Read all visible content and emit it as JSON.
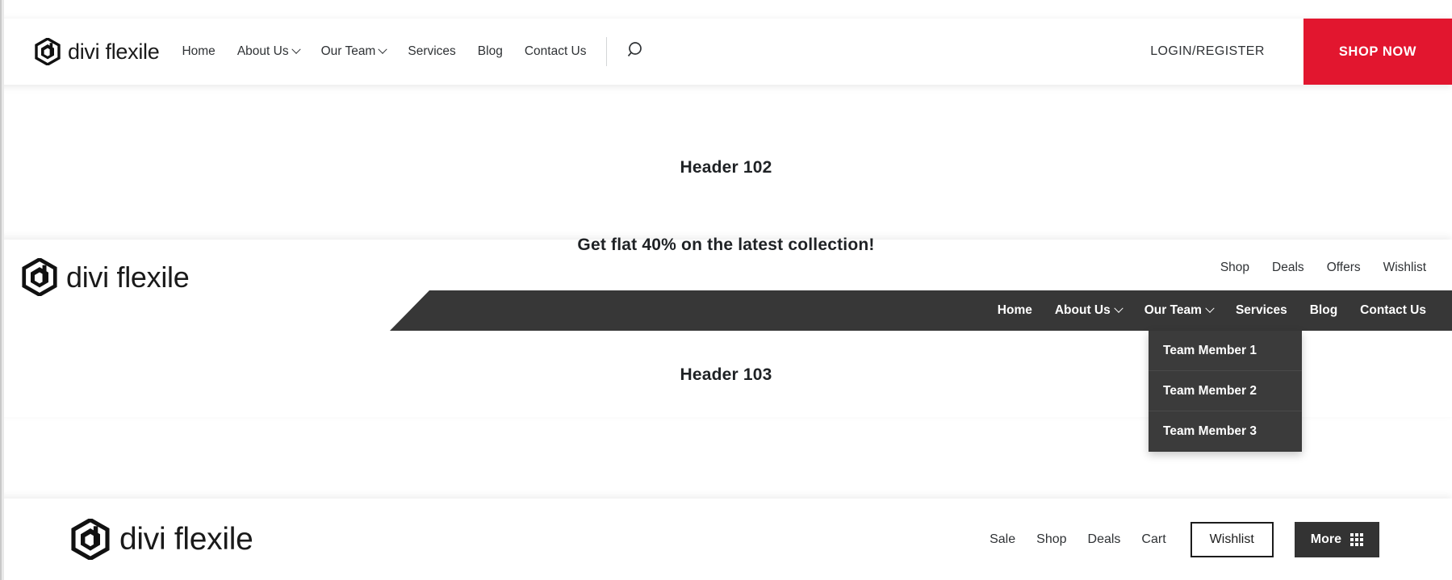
{
  "brand": {
    "name": "divi flexile",
    "logo_icon": "hexagon-d-logo"
  },
  "colors": {
    "accent_red": "#e2162f",
    "dark_bar": "#373737",
    "dropdown_bg": "#3b3b3b",
    "more_button": "#333333",
    "text": "#2f3235"
  },
  "header_102": {
    "label": "Header 102",
    "nav": [
      {
        "label": "Home",
        "has_caret": false
      },
      {
        "label": "About Us",
        "has_caret": true
      },
      {
        "label": "Our Team",
        "has_caret": true
      },
      {
        "label": "Services",
        "has_caret": false
      },
      {
        "label": "Blog",
        "has_caret": false
      },
      {
        "label": "Contact Us",
        "has_caret": false
      }
    ],
    "search_icon": "search-icon",
    "login_label": "LOGIN/REGISTER",
    "shop_now_label": "SHOP NOW"
  },
  "header_103": {
    "label": "Header 103",
    "promo_text": "Get flat 40% on the latest collection!",
    "utility_links": [
      "Shop",
      "Deals",
      "Offers",
      "Wishlist"
    ],
    "nav": [
      {
        "label": "Home",
        "has_caret": false
      },
      {
        "label": "About Us",
        "has_caret": true
      },
      {
        "label": "Our Team",
        "has_caret": true
      },
      {
        "label": "Services",
        "has_caret": false
      },
      {
        "label": "Blog",
        "has_caret": false
      },
      {
        "label": "Contact Us",
        "has_caret": false
      }
    ],
    "dropdown": {
      "parent": "Our Team",
      "items": [
        "Team Member 1",
        "Team Member 2",
        "Team Member 3"
      ]
    }
  },
  "header_104": {
    "links": [
      "Sale",
      "Shop",
      "Deals",
      "Cart"
    ],
    "wishlist_label": "Wishlist",
    "more_label": "More",
    "more_icon": "grid-icon"
  }
}
